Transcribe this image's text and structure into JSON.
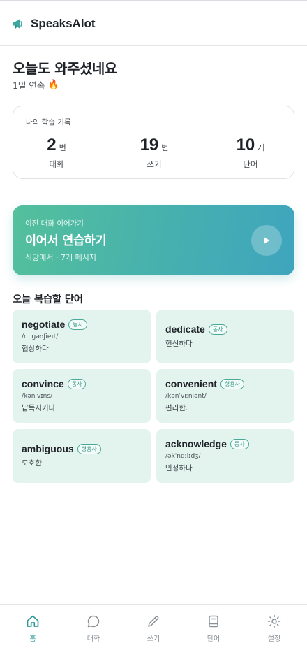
{
  "colors": {
    "accent": "#2f9a98",
    "card_gradient_start": "#54c09b",
    "card_gradient_end": "#3ea5bd",
    "word_card_bg": "#e3f4ee",
    "nav_inactive": "#8a9096"
  },
  "header": {
    "logo_icon": "megaphone-icon",
    "title": "SpeaksAlot"
  },
  "home": {
    "greeting": "오늘도 와주셨네요",
    "streak_text": "1일 연속",
    "streak_icon": "🔥"
  },
  "stats": {
    "title": "나의 학습 기록",
    "items": [
      {
        "value": "2",
        "unit": "번",
        "label": "대화"
      },
      {
        "value": "19",
        "unit": "번",
        "label": "쓰기"
      },
      {
        "value": "10",
        "unit": "개",
        "label": "단어"
      }
    ]
  },
  "continue": {
    "subtitle": "이전 대화 이어가기",
    "title": "이어서 연습하기",
    "meta": "식당에서 · 7개 메시지",
    "play_icon": "play-icon"
  },
  "review": {
    "title": "오늘 복습할 단어",
    "words": [
      {
        "word": "negotiate",
        "pos": "동사",
        "phonetic": "/nɪˈɡəʊʃieɪt/",
        "meaning": "협상하다"
      },
      {
        "word": "dedicate",
        "pos": "동사",
        "phonetic": "",
        "meaning": "헌신하다"
      },
      {
        "word": "convince",
        "pos": "동사",
        "phonetic": "/kənˈvɪns/",
        "meaning": "납득시키다"
      },
      {
        "word": "convenient",
        "pos": "형용사",
        "phonetic": "/kənˈviːniənt/",
        "meaning": "편리한."
      },
      {
        "word": "ambiguous",
        "pos": "형용사",
        "phonetic": "",
        "meaning": "모호한"
      },
      {
        "word": "acknowledge",
        "pos": "동사",
        "phonetic": "/əkˈnɑːlɪdʒ/",
        "meaning": "인정하다"
      }
    ]
  },
  "nav": {
    "active_index": 0,
    "items": [
      {
        "label": "홈",
        "icon": "home-icon"
      },
      {
        "label": "대화",
        "icon": "chat-bubble-icon"
      },
      {
        "label": "쓰기",
        "icon": "pencil-icon"
      },
      {
        "label": "단어",
        "icon": "book-icon"
      },
      {
        "label": "설정",
        "icon": "gear-icon"
      }
    ]
  }
}
